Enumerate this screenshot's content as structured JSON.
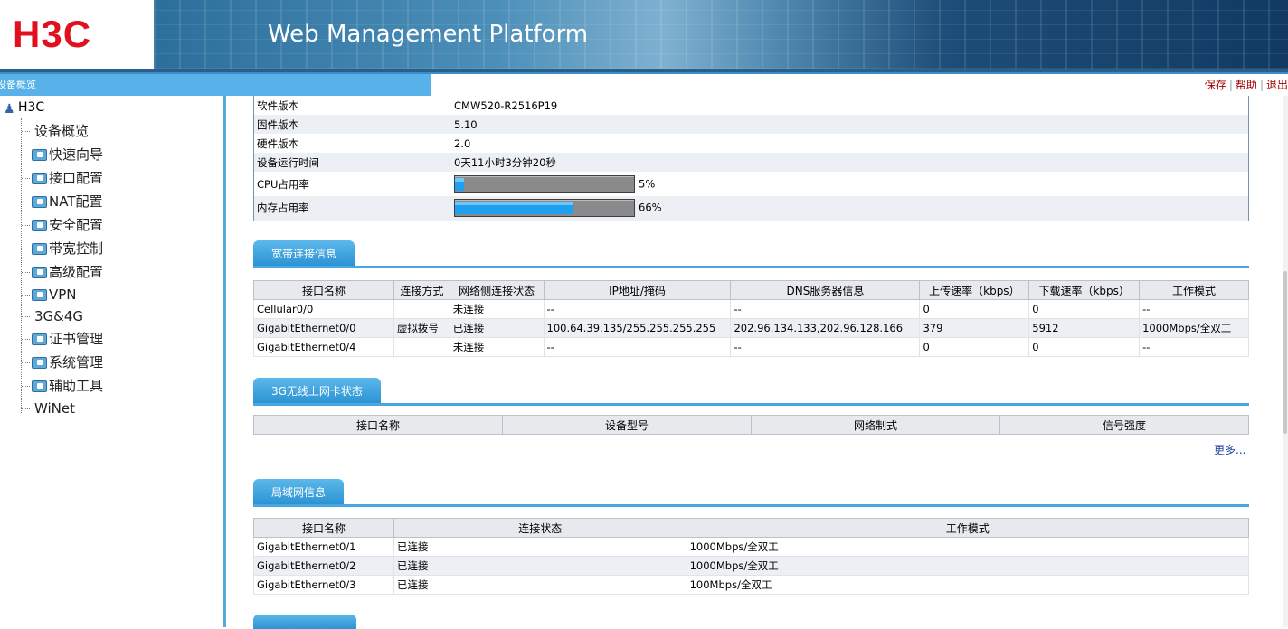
{
  "header": {
    "logo": "H3C",
    "title": "Web Management Platform"
  },
  "nav": {
    "title": "设备概览",
    "links": [
      "保存",
      "帮助",
      "退出"
    ]
  },
  "sidebar": {
    "root": "H3C",
    "items": [
      {
        "label": "设备概览",
        "folder": false
      },
      {
        "label": "快速向导",
        "folder": true
      },
      {
        "label": "接口配置",
        "folder": true
      },
      {
        "label": "NAT配置",
        "folder": true
      },
      {
        "label": "安全配置",
        "folder": true
      },
      {
        "label": "带宽控制",
        "folder": true
      },
      {
        "label": "高级配置",
        "folder": true
      },
      {
        "label": "VPN",
        "folder": true
      },
      {
        "label": "3G&4G",
        "folder": false
      },
      {
        "label": "证书管理",
        "folder": true
      },
      {
        "label": "系统管理",
        "folder": true
      },
      {
        "label": "辅助工具",
        "folder": true
      },
      {
        "label": "WiNet",
        "folder": false
      }
    ]
  },
  "device_info": {
    "rows": [
      {
        "k": "软件版本",
        "v": "CMW520-R2516P19"
      },
      {
        "k": "固件版本",
        "v": "5.10"
      },
      {
        "k": "硬件版本",
        "v": "2.0"
      },
      {
        "k": "设备运行时间",
        "v": "0天11小时3分钟20秒"
      }
    ],
    "cpu": {
      "label": "CPU占用率",
      "value": "5%",
      "fraction": 0.05
    },
    "mem": {
      "label": "内存占用率",
      "value": "66%",
      "fraction": 0.66
    }
  },
  "broadband": {
    "title": "宽带连接信息",
    "headers": [
      "接口名称",
      "连接方式",
      "网络侧连接状态",
      "IP地址/掩码",
      "DNS服务器信息",
      "上传速率（kbps）",
      "下载速率（kbps）",
      "工作模式"
    ],
    "rows": [
      [
        "Cellular0/0",
        "",
        "未连接",
        "--",
        "--",
        "0",
        "0",
        "--"
      ],
      [
        "GigabitEthernet0/0",
        "虚拟拨号",
        "已连接",
        "100.64.39.135/255.255.255.255",
        "202.96.134.133,202.96.128.166",
        "379",
        "5912",
        "1000Mbps/全双工"
      ],
      [
        "GigabitEthernet0/4",
        "",
        "未连接",
        "--",
        "--",
        "0",
        "0",
        "--"
      ]
    ]
  },
  "wireless": {
    "title": "3G无线上网卡状态",
    "headers": [
      "接口名称",
      "设备型号",
      "网络制式",
      "信号强度"
    ],
    "more": "更多..."
  },
  "lan": {
    "title": "局域网信息",
    "headers": [
      "接口名称",
      "连接状态",
      "工作模式"
    ],
    "rows": [
      [
        "GigabitEthernet0/1",
        "已连接",
        "1000Mbps/全双工"
      ],
      [
        "GigabitEthernet0/2",
        "已连接",
        "1000Mbps/全双工"
      ],
      [
        "GigabitEthernet0/3",
        "已连接",
        "100Mbps/全双工"
      ]
    ]
  }
}
